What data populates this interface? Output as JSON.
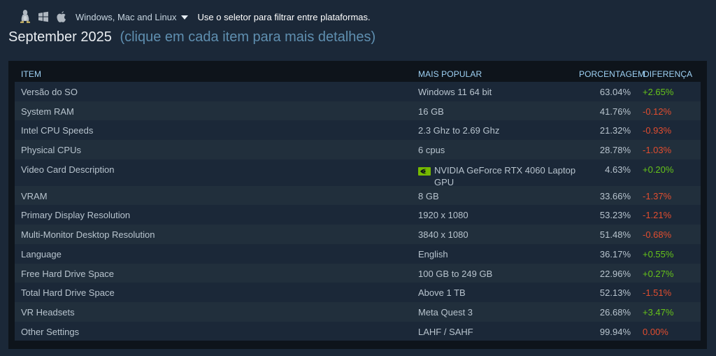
{
  "platform_bar": {
    "icons": [
      "linux-icon",
      "windows-icon",
      "apple-icon"
    ],
    "selected": "Windows, Mac and Linux",
    "hint": "Use o seletor para filtrar entre plataformas."
  },
  "heading": {
    "month": "September 2025",
    "subtitle": "(clique em cada item para mais detalhes)"
  },
  "table": {
    "headers": {
      "item": "ITEM",
      "popular": "MAIS POPULAR",
      "percentage": "PORCENTAGEM",
      "difference": "DIFERENÇA"
    },
    "rows": [
      {
        "item": "Versão do SO",
        "popular": "Windows 11 64 bit",
        "percentage": "63.04%",
        "difference": "+2.65%",
        "trend": "up"
      },
      {
        "item": "System RAM",
        "popular": "16 GB",
        "percentage": "41.76%",
        "difference": "-0.12%",
        "trend": "down"
      },
      {
        "item": "Intel CPU Speeds",
        "popular": "2.3 Ghz to 2.69 Ghz",
        "percentage": "21.32%",
        "difference": "-0.93%",
        "trend": "down"
      },
      {
        "item": "Physical CPUs",
        "popular": "6 cpus",
        "percentage": "28.78%",
        "difference": "-1.03%",
        "trend": "down"
      },
      {
        "item": "Video Card Description",
        "popular": "NVIDIA GeForce RTX 4060 Laptop GPU",
        "popular_icon": "nvidia-icon",
        "percentage": "4.63%",
        "difference": "+0.20%",
        "trend": "up"
      },
      {
        "item": "VRAM",
        "popular": "8 GB",
        "percentage": "33.66%",
        "difference": "-1.37%",
        "trend": "down"
      },
      {
        "item": "Primary Display Resolution",
        "popular": "1920 x 1080",
        "percentage": "53.23%",
        "difference": "-1.21%",
        "trend": "down"
      },
      {
        "item": "Multi-Monitor Desktop Resolution",
        "popular": "3840 x 1080",
        "percentage": "51.48%",
        "difference": "-0.68%",
        "trend": "down"
      },
      {
        "item": "Language",
        "popular": "English",
        "percentage": "36.17%",
        "difference": "+0.55%",
        "trend": "up"
      },
      {
        "item": "Free Hard Drive Space",
        "popular": "100 GB to 249 GB",
        "percentage": "22.96%",
        "difference": "+0.27%",
        "trend": "up"
      },
      {
        "item": "Total Hard Drive Space",
        "popular": "Above 1 TB",
        "percentage": "52.13%",
        "difference": "-1.51%",
        "trend": "down"
      },
      {
        "item": "VR Headsets",
        "popular": "Meta Quest 3",
        "percentage": "26.68%",
        "difference": "+3.47%",
        "trend": "up"
      },
      {
        "item": "Other Settings",
        "popular": "LAHF / SAHF",
        "percentage": "99.94%",
        "difference": "0.00%",
        "trend": "down"
      }
    ]
  },
  "colors": {
    "background": "#1b2838",
    "table_bg": "#0e141b",
    "header_text": "#9fd2f5",
    "positive": "#66c31a",
    "negative": "#e24d2f",
    "subtitle": "#5f8fb0"
  }
}
